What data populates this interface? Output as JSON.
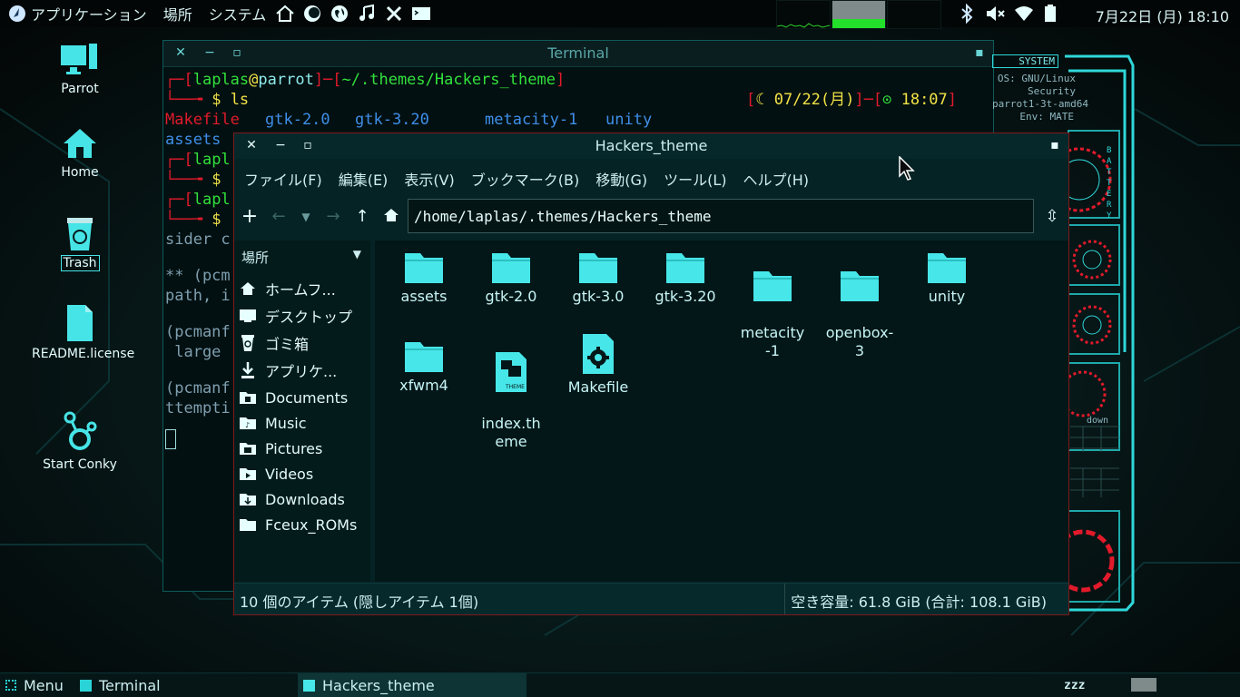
{
  "top_panel": {
    "menus": [
      "アプリケーション",
      "場所",
      "システム"
    ],
    "launcher_icons": [
      "home-icon",
      "thunderbird-icon",
      "globe-icon",
      "music-icon",
      "x-tools-icon",
      "terminal-icon"
    ],
    "tray_icons": [
      "bluetooth-icon",
      "volume-muted-icon",
      "wifi-icon",
      "battery-icon"
    ],
    "clock": "7月22日 (月) 18:10"
  },
  "desktop": {
    "icons": [
      {
        "label": "Parrot",
        "icon": "computer-icon"
      },
      {
        "label": "Home",
        "icon": "home-folder-icon"
      },
      {
        "label": "Trash",
        "icon": "trash-icon"
      },
      {
        "label": "README.license",
        "icon": "document-icon"
      },
      {
        "label": "Start Conky",
        "icon": "conky-icon"
      }
    ]
  },
  "terminal": {
    "title": "Terminal",
    "prompt_user": "laplas",
    "prompt_at": "@",
    "prompt_host": "parrot",
    "prompt_path": "~/.themes/Hackers_theme",
    "command": "ls",
    "right_prompt_date": "07/22(月)",
    "right_prompt_time": "18:07",
    "ls_row1": {
      "makefile": "Makefile",
      "gtk2": "gtk-2.0",
      "gtk320": "gtk-3.20",
      "metacity": "metacity-1",
      "unity": "unity"
    },
    "ls_row2_partial": "assets",
    "partial_user": "lapl",
    "dollar": "$",
    "fragments": [
      "sider c",
      "** (pcm",
      "path, i",
      "(pcmanf",
      " large",
      "(pcmanf",
      "ttempti"
    ]
  },
  "file_manager": {
    "title": "Hackers_theme",
    "menu": [
      "ファイル(F)",
      "編集(E)",
      "表示(V)",
      "ブックマーク(B)",
      "移動(G)",
      "ツール(L)",
      "ヘルプ(H)"
    ],
    "path": "/home/laplas/.themes/Hackers_theme",
    "sidebar_header": "場所",
    "sidebar_items": [
      {
        "label": "ホームフ...",
        "icon": "home-icon"
      },
      {
        "label": "デスクトップ",
        "icon": "desktop-icon"
      },
      {
        "label": "ゴミ箱",
        "icon": "trash-icon"
      },
      {
        "label": "アプリケ...",
        "icon": "download-icon"
      },
      {
        "label": "Documents",
        "icon": "folder-documents-icon"
      },
      {
        "label": "Music",
        "icon": "folder-music-icon"
      },
      {
        "label": "Pictures",
        "icon": "folder-pictures-icon"
      },
      {
        "label": "Videos",
        "icon": "folder-videos-icon"
      },
      {
        "label": "Downloads",
        "icon": "folder-downloads-icon"
      },
      {
        "label": "Fceux_ROMs",
        "icon": "folder-icon"
      }
    ],
    "files": [
      {
        "name": "assets",
        "type": "folder"
      },
      {
        "name": "gtk-2.0",
        "type": "folder"
      },
      {
        "name": "gtk-3.0",
        "type": "folder"
      },
      {
        "name": "gtk-3.20",
        "type": "folder"
      },
      {
        "name": "metacity\n-1",
        "type": "folder"
      },
      {
        "name": "openbox-\n3",
        "type": "folder"
      },
      {
        "name": "unity",
        "type": "folder"
      },
      {
        "name": "xfwm4",
        "type": "folder"
      },
      {
        "name": "index.th\neme",
        "type": "theme-file"
      },
      {
        "name": "Makefile",
        "type": "settings-file"
      }
    ],
    "status_left": "10 個のアイテム (隠しアイテム 1個)",
    "status_right": "空き容量: 61.8 GiB (合計: 108.1 GiB)"
  },
  "hud": {
    "label": "SYSTEM",
    "info_lines": [
      "OS: GNU/Linux",
      "Security",
      "parrot1-3t-amd64",
      "Env: MATE",
      "BATTERY",
      "down"
    ]
  },
  "bottom_panel": {
    "menu_label": "Menu",
    "tasks": [
      "Terminal",
      "Hackers_theme"
    ],
    "sleep_indicator": "zzz"
  },
  "colors": {
    "accent": "#2fd7d9",
    "prompt_red": "#e21a2b",
    "prompt_green": "#33e03b",
    "prompt_yellow": "#f2e246",
    "ls_blue": "#3f8ee8",
    "folder": "#47e6e8"
  }
}
